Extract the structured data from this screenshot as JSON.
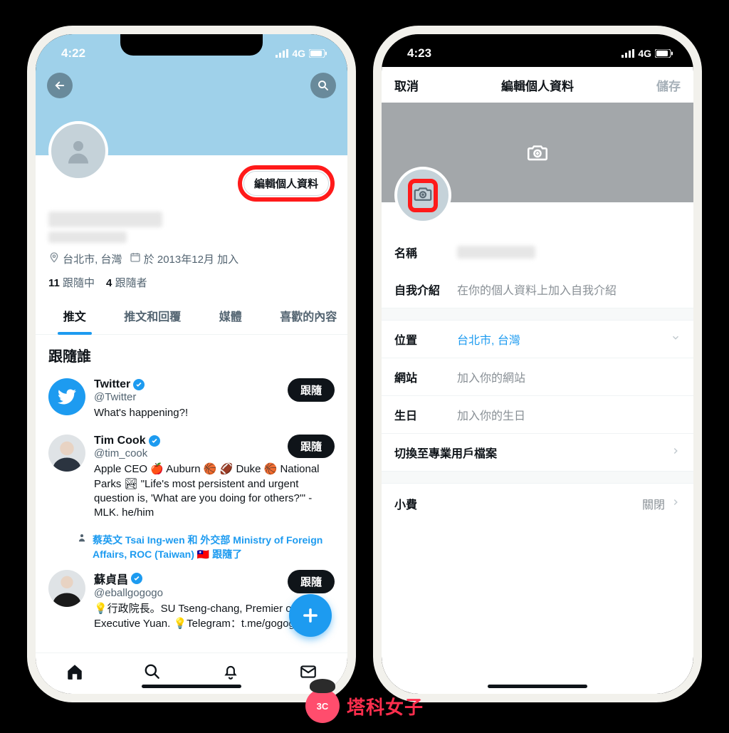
{
  "phone1": {
    "status_time": "4:22",
    "status_net": "4G",
    "edit_profile_btn": "編輯個人資料",
    "location_text": "台北市, 台灣",
    "joined_text": "於 2013年12月 加入",
    "following_count": "11",
    "following_label": "跟隨中",
    "followers_count": "4",
    "followers_label": "跟隨者",
    "tabs": {
      "tweets": "推文",
      "replies": "推文和回覆",
      "media": "媒體",
      "likes": "喜歡的內容"
    },
    "who_to_follow_title": "跟隨誰",
    "follow_btn": "跟隨",
    "sugg1": {
      "name": "Twitter",
      "handle": "@Twitter",
      "bio": "What's happening?!"
    },
    "sugg2": {
      "name": "Tim Cook",
      "handle": "@tim_cook",
      "bio": "Apple CEO 🍎 Auburn 🏀 🏈 Duke 🏀 National Parks 🏞 \"Life's most persistent and urgent question is, 'What are you doing for others?'\" - MLK. he/him"
    },
    "context_text": "蔡英文 Tsai Ing-wen 和 外交部 Ministry of Foreign Affairs, ROC (Taiwan) 🇹🇼 跟隨了",
    "sugg3": {
      "name": "蘇貞昌",
      "handle": "@eballgogogo",
      "bio": "💡行政院長。SU Tseng-chang, Premier of the Executive Yuan. 💡Telegram：t.me/gogogoeball"
    }
  },
  "phone2": {
    "status_time": "4:23",
    "status_net": "4G",
    "toolbar": {
      "cancel": "取消",
      "title": "編輯個人資料",
      "save": "儲存"
    },
    "rows": {
      "name_label": "名稱",
      "bio_label": "自我介紹",
      "bio_placeholder": "在你的個人資料上加入自我介紹",
      "location_label": "位置",
      "location_value": "台北市, 台灣",
      "website_label": "網站",
      "website_placeholder": "加入你的網站",
      "birthday_label": "生日",
      "birthday_placeholder": "加入你的生日",
      "switch_pro": "切換至專業用戶檔案",
      "tip_label": "小費",
      "tip_status": "關閉"
    }
  },
  "watermark": "塔科女子"
}
